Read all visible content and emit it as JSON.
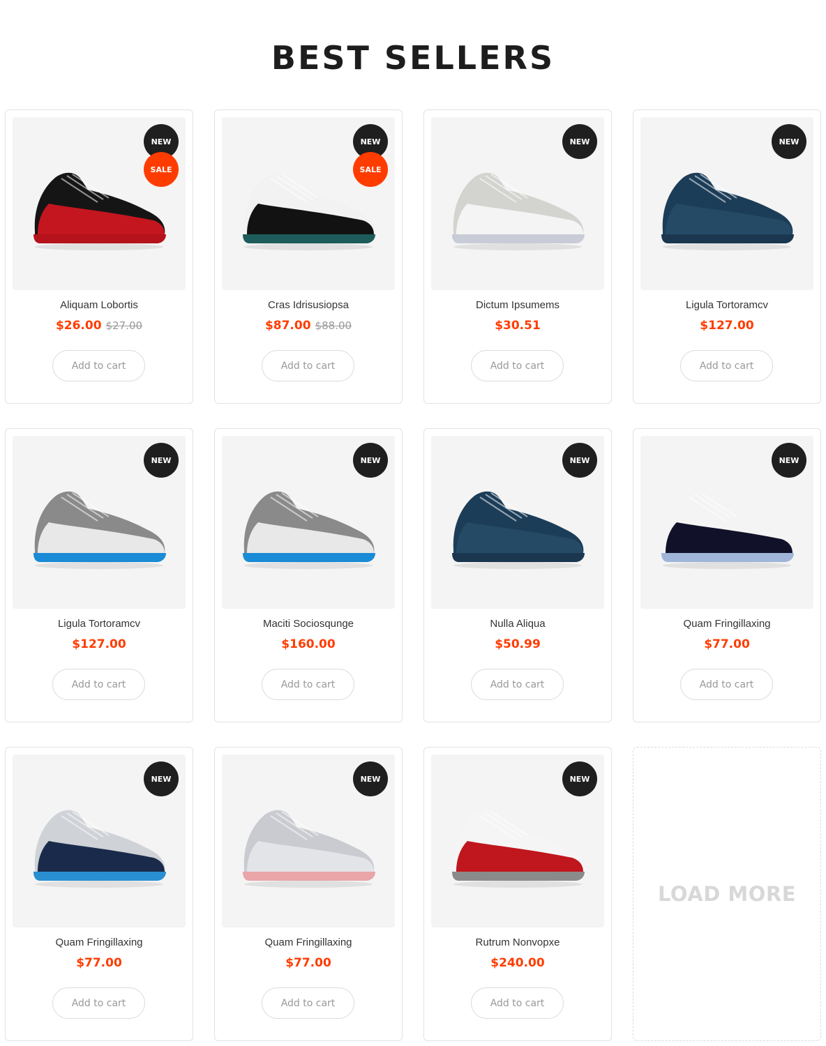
{
  "section": {
    "title": "BEST SELLERS"
  },
  "badges": {
    "new": "NEW",
    "sale": "SALE"
  },
  "colors": {
    "accent": "#ff3c00",
    "badge_dark": "#1f1f1f",
    "image_bg": "#f4f4f4"
  },
  "products": [
    {
      "name": "Aliquam Lobortis",
      "price": "$26.00",
      "old_price": "$27.00",
      "is_new": true,
      "on_sale": true,
      "cart_label": "Add to cart",
      "image": "black-red-high-top-sneaker",
      "c1": "#151515",
      "c2": "#c4161f",
      "c3": "#b5121b"
    },
    {
      "name": "Cras Idrisusiopsa",
      "price": "$87.00",
      "old_price": "$88.00",
      "is_new": true,
      "on_sale": true,
      "cart_label": "Add to cart",
      "image": "white-black-sneaker",
      "c1": "#f2f2f2",
      "c2": "#121212",
      "c3": "#1d5c5a"
    },
    {
      "name": "Dictum Ipsumems",
      "price": "$30.51",
      "is_new": true,
      "on_sale": false,
      "cart_label": "Add to cart",
      "image": "grey-woven-runner",
      "c1": "#d3d3d0",
      "c2": "#f4f4f4",
      "c3": "#c8ccd6"
    },
    {
      "name": "Ligula Tortoramcv",
      "price": "$127.00",
      "is_new": true,
      "on_sale": false,
      "cart_label": "Add to cart",
      "image": "navy-high-top-sneaker",
      "c1": "#1c3d58",
      "c2": "#244a66",
      "c3": "#1b3750"
    },
    {
      "name": "Ligula Tortoramcv",
      "price": "$127.00",
      "is_new": true,
      "on_sale": false,
      "cart_label": "Add to cart",
      "image": "grey-blue-sneaker",
      "c1": "#8a8a8a",
      "c2": "#e8e8e8",
      "c3": "#1a8bd6"
    },
    {
      "name": "Maciti Sociosqunge",
      "price": "$160.00",
      "is_new": true,
      "on_sale": false,
      "cart_label": "Add to cart",
      "image": "grey-blue-sneaker",
      "c1": "#8a8a8a",
      "c2": "#e8e8e8",
      "c3": "#1a8bd6"
    },
    {
      "name": "Nulla Aliqua",
      "price": "$50.99",
      "is_new": true,
      "on_sale": false,
      "cart_label": "Add to cart",
      "image": "navy-high-top-sneaker",
      "c1": "#1c3d58",
      "c2": "#244a66",
      "c3": "#1b3750"
    },
    {
      "name": "Quam Fringillaxing",
      "price": "$77.00",
      "is_new": true,
      "on_sale": false,
      "cart_label": "Add to cart",
      "image": "white-navy-sneaker",
      "c1": "#f4f4f4",
      "c2": "#11122a",
      "c3": "#9fb6d8"
    },
    {
      "name": "Quam Fringillaxing",
      "price": "$77.00",
      "is_new": true,
      "on_sale": false,
      "cart_label": "Add to cart",
      "image": "grey-navy-sneaker",
      "c1": "#cfd2d6",
      "c2": "#1a2a4a",
      "c3": "#2a8fd1"
    },
    {
      "name": "Quam Fringillaxing",
      "price": "$77.00",
      "is_new": true,
      "on_sale": false,
      "cart_label": "Add to cart",
      "image": "silver-knit-sneaker",
      "c1": "#c9cbd0",
      "c2": "#e3e4e8",
      "c3": "#e9a5a8"
    },
    {
      "name": "Rutrum Nonvopxe",
      "price": "$240.00",
      "is_new": true,
      "on_sale": false,
      "cart_label": "Add to cart",
      "image": "white-red-sneaker",
      "c1": "#f5f5f5",
      "c2": "#c0161d",
      "c3": "#8b8b8b"
    }
  ],
  "load_more": {
    "label": "LOAD MORE"
  }
}
